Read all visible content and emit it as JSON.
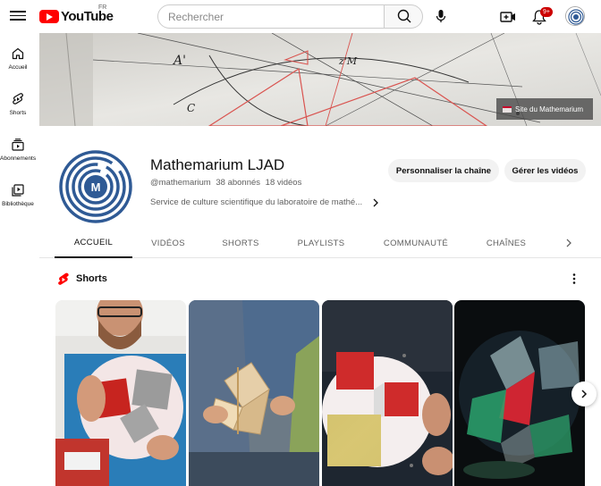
{
  "header": {
    "logo_text": "YouTube",
    "country_code": "FR",
    "search_placeholder": "Rechercher",
    "notification_count": "9+"
  },
  "sidebar": {
    "items": [
      {
        "label": "Accueil",
        "icon": "home-icon"
      },
      {
        "label": "Shorts",
        "icon": "shorts-icon"
      },
      {
        "label": "Abonnements",
        "icon": "subscriptions-icon"
      },
      {
        "label": "Bibliothèque",
        "icon": "library-icon"
      }
    ]
  },
  "banner": {
    "site_link": "Site du Mathemarium"
  },
  "channel": {
    "avatar_letter": "M",
    "name": "Mathemarium LJAD",
    "handle": "@mathemarium",
    "subscribers": "38 abonnés",
    "videos": "18 vidéos",
    "description": "Service de culture scientifique du laboratoire de mathé...",
    "customize_label": "Personnaliser la chaîne",
    "manage_label": "Gérer les vidéos"
  },
  "tabs": [
    {
      "label": "ACCUEIL",
      "active": true
    },
    {
      "label": "VIDÉOS",
      "active": false
    },
    {
      "label": "SHORTS",
      "active": false
    },
    {
      "label": "PLAYLISTS",
      "active": false
    },
    {
      "label": "COMMUNAUTÉ",
      "active": false
    },
    {
      "label": "CHAÎNES",
      "active": false
    }
  ],
  "shorts_shelf": {
    "title": "Shorts"
  },
  "colors": {
    "brand_red": "#ff0000",
    "avatar_blue": "#2f5a95",
    "text_primary": "#0f0f0f",
    "text_secondary": "#606060"
  }
}
